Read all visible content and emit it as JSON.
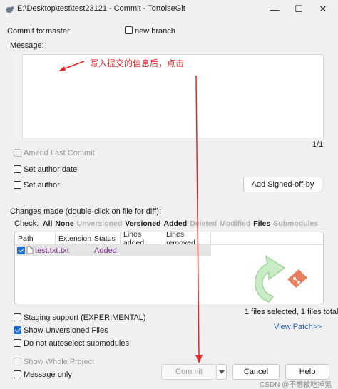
{
  "window": {
    "title": "E:\\Desktop\\test\\test23121 - Commit - TortoiseGit",
    "minimize": "—",
    "maximize": "☐",
    "close": "✕"
  },
  "commit_to": {
    "label": "Commit to:",
    "branch": "master",
    "new_branch_label": "new branch",
    "new_branch_checked": false
  },
  "message": {
    "label": "Message:",
    "value": "",
    "position": "1/1",
    "annotation": "写入提交的信息后，点击"
  },
  "options": {
    "amend_last_commit": "Amend Last Commit",
    "set_author_date": "Set author date",
    "set_author": "Set author",
    "add_signed_off_by": "Add Signed-off-by"
  },
  "changes": {
    "label": "Changes made (double-click on file for diff):",
    "check_label": "Check:",
    "filters": [
      {
        "label": "All",
        "dim": false
      },
      {
        "label": "None",
        "dim": false
      },
      {
        "label": "Unversioned",
        "dim": true
      },
      {
        "label": "Versioned",
        "dim": false
      },
      {
        "label": "Added",
        "dim": false
      },
      {
        "label": "Deleted",
        "dim": true
      },
      {
        "label": "Modified",
        "dim": true
      },
      {
        "label": "Files",
        "dim": false
      },
      {
        "label": "Submodules",
        "dim": true
      }
    ],
    "columns": [
      "Path",
      "Extension",
      "Status",
      "Lines added",
      "Lines removed"
    ],
    "rows": [
      {
        "path": "test.txt",
        "extension": ".txt",
        "status": "Added",
        "lines_added": "",
        "lines_removed": "",
        "checked": true
      }
    ],
    "summary": "1 files selected, 1 files total",
    "view_patch": "View Patch>>"
  },
  "bottom_options": {
    "staging_support": "Staging support (EXPERIMENTAL)",
    "show_unversioned": "Show Unversioned Files",
    "show_unversioned_checked": true,
    "no_autoselect_submodules": "Do not autoselect submodules",
    "show_whole_project": "Show Whole Project",
    "message_only": "Message only"
  },
  "buttons": {
    "commit": "Commit",
    "cancel": "Cancel",
    "help": "Help"
  },
  "watermark": "CSDN @不想被吃掉氪",
  "colors": {
    "annotation": "#e5252a",
    "link": "#2a5db0",
    "added_status": "#7b2c8c",
    "accent": "#1f6fd1"
  }
}
